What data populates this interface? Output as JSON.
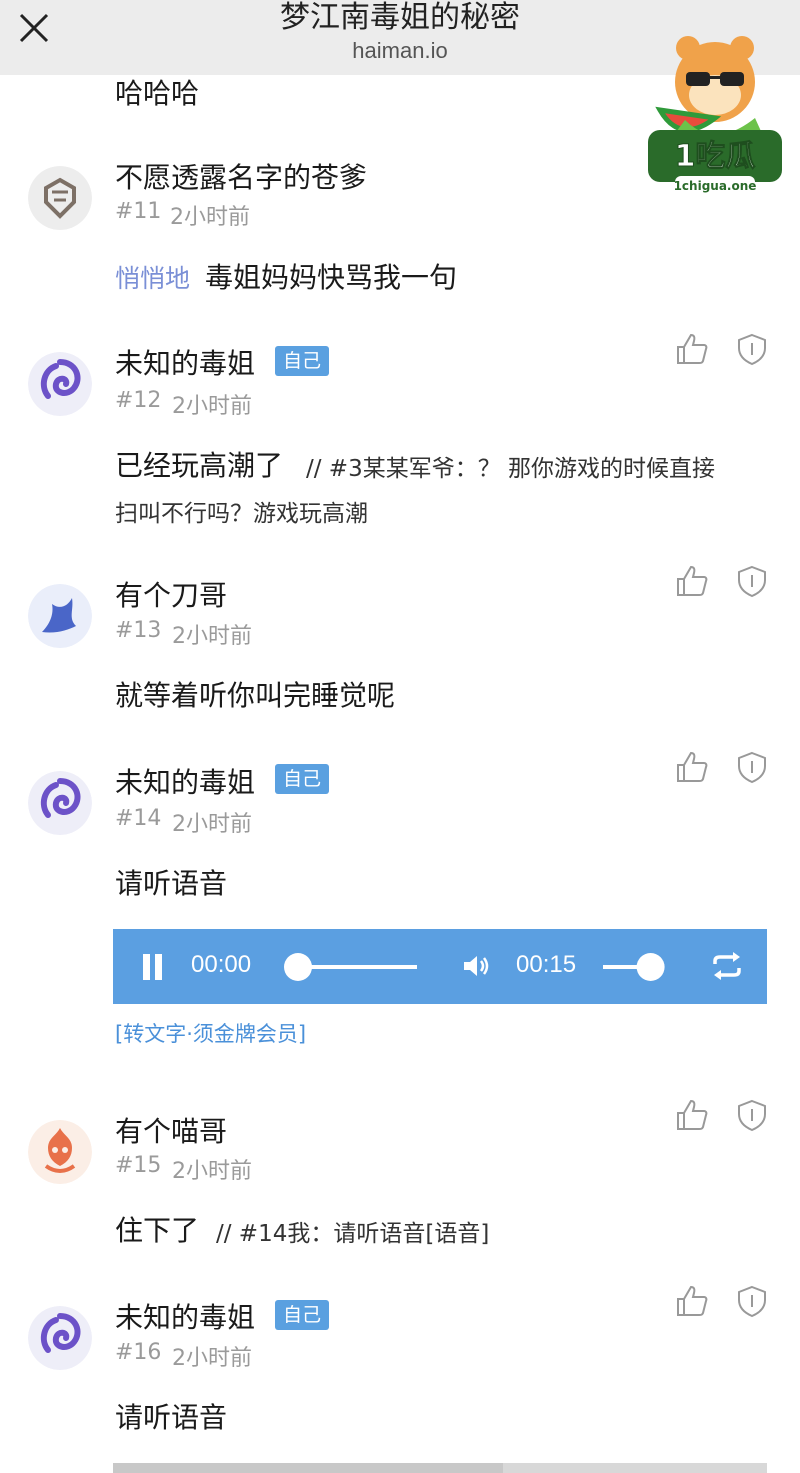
{
  "header": {
    "title": "梦江南毒姐的秘密",
    "domain": "haiman.io"
  },
  "watermark": {
    "brand": "1吃瓜",
    "site": "1chigua.one"
  },
  "top_text": "哈哈哈",
  "comments": [
    {
      "username": "不愿透露名字的苍爹",
      "floor": "#11",
      "time": "2小时前",
      "whisper_label": "悄悄地",
      "text": "毒姐妈妈快骂我一句"
    },
    {
      "username": "未知的毒姐",
      "badge": "自己",
      "floor": "#12",
      "time": "2小时前",
      "text": "已经玩高潮了",
      "quote_line1": "// #3某某军爷：？ 那你游戏的时候直接",
      "quote_line2": "扫叫不行吗？游戏玩高潮"
    },
    {
      "username": "有个刀哥",
      "floor": "#13",
      "time": "2小时前",
      "text": "就等着听你叫完睡觉呢"
    },
    {
      "username": "未知的毒姐",
      "badge": "自己",
      "floor": "#14",
      "time": "2小时前",
      "text": "请听语音",
      "audio": {
        "current_time": "00:00",
        "duration": "00:15",
        "progress": 0,
        "volume": 0.8
      },
      "transcribe_label": "[转文字·须金牌会员]"
    },
    {
      "username": "有个喵哥",
      "floor": "#15",
      "time": "2小时前",
      "text": "住下了",
      "quote": "// #14我：请听语音[语音]"
    },
    {
      "username": "未知的毒姐",
      "badge": "自己",
      "floor": "#16",
      "time": "2小时前",
      "text": "请听语音"
    }
  ],
  "colors": {
    "header_bg": "#ececec",
    "badge_bg": "#5aa0e0",
    "player_bg": "#5b9fe1",
    "whisper": "#7a8fd6",
    "link": "#4a90d9"
  }
}
